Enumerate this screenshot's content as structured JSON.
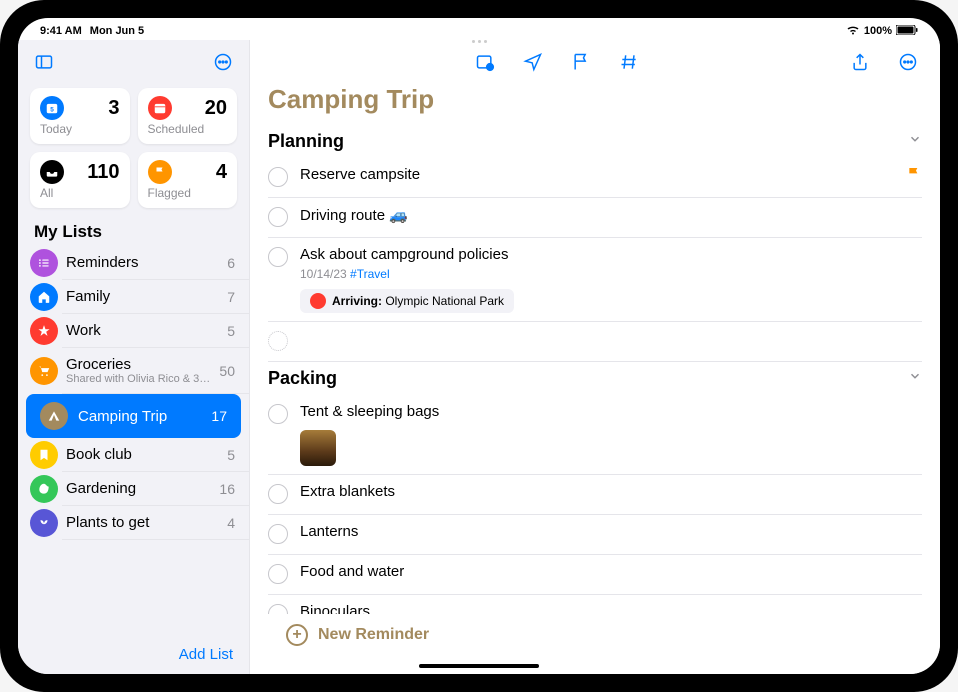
{
  "status_bar": {
    "time": "9:41 AM",
    "date": "Mon Jun 5",
    "battery": "100%"
  },
  "colors": {
    "accent": "#007aff",
    "title": "#a38a5e"
  },
  "sidebar": {
    "smart_lists": [
      {
        "name": "today",
        "label": "Today",
        "count": "3",
        "color": "#007aff"
      },
      {
        "name": "scheduled",
        "label": "Scheduled",
        "count": "20",
        "color": "#ff3b30"
      },
      {
        "name": "all",
        "label": "All",
        "count": "110",
        "color": "#000000"
      },
      {
        "name": "flagged",
        "label": "Flagged",
        "count": "4",
        "color": "#ff9500"
      }
    ],
    "lists_header": "My Lists",
    "lists": [
      {
        "name": "Reminders",
        "count": "6",
        "color": "#af52de",
        "icon": "list"
      },
      {
        "name": "Family",
        "count": "7",
        "color": "#007aff",
        "icon": "house"
      },
      {
        "name": "Work",
        "count": "5",
        "color": "#ff3b30",
        "icon": "star"
      },
      {
        "name": "Groceries",
        "count": "50",
        "color": "#ff9500",
        "icon": "cart",
        "subtitle": "Shared with Olivia Rico & 3…"
      },
      {
        "name": "Camping Trip",
        "count": "17",
        "color": "#a38a5e",
        "icon": "tent",
        "selected": true
      },
      {
        "name": "Book club",
        "count": "5",
        "color": "#ffcc00",
        "icon": "bookmark"
      },
      {
        "name": "Gardening",
        "count": "16",
        "color": "#34c759",
        "icon": "leaf"
      },
      {
        "name": "Plants to get",
        "count": "4",
        "color": "#5856d6",
        "icon": "plant"
      }
    ],
    "add_list": "Add List"
  },
  "main": {
    "title": "Camping Trip",
    "sections": [
      {
        "title": "Planning",
        "items": [
          {
            "title": "Reserve campsite",
            "flagged": true
          },
          {
            "title": "Driving route 🚙"
          },
          {
            "title": "Ask about campground policies",
            "meta_date": "10/14/23",
            "meta_tag": "#Travel",
            "location_label": "Arriving:",
            "location_value": "Olympic National Park"
          },
          {
            "title": "",
            "dotted": true
          }
        ]
      },
      {
        "title": "Packing",
        "items": [
          {
            "title": "Tent & sleeping bags",
            "has_image": true
          },
          {
            "title": "Extra blankets"
          },
          {
            "title": "Lanterns"
          },
          {
            "title": "Food and water"
          },
          {
            "title": "Binoculars"
          }
        ]
      }
    ],
    "new_reminder": "New Reminder"
  }
}
